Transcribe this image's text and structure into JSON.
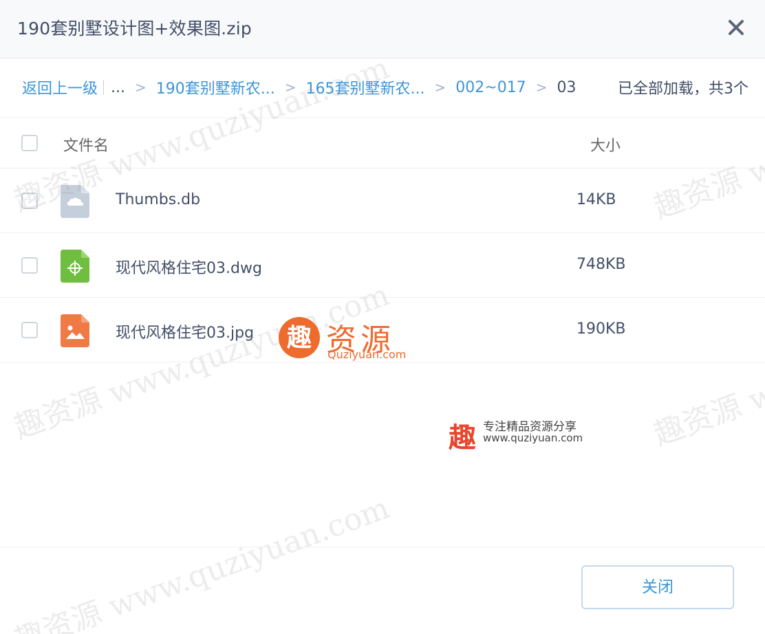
{
  "dialog": {
    "title": "190套别墅设计图+效果图.zip",
    "close_icon": "close-icon"
  },
  "breadcrumb": {
    "back_label": "返回上一级",
    "ellipsis": "...",
    "separator": ">",
    "items": [
      {
        "label": "190套别墅新农..."
      },
      {
        "label": "165套别墅新农..."
      },
      {
        "label": "002~017"
      }
    ],
    "current": "03"
  },
  "status": {
    "loaded_text": "已全部加载，共3个"
  },
  "list": {
    "header": {
      "name_label": "文件名",
      "size_label": "大小"
    },
    "files": [
      {
        "name": "Thumbs.db",
        "size": "14KB",
        "icon": "generic-file-icon",
        "color": "#c5cfdb"
      },
      {
        "name": "现代风格住宅03.dwg",
        "size": "748KB",
        "icon": "dwg-file-icon",
        "color": "#6fbe3f"
      },
      {
        "name": "现代风格住宅03.jpg",
        "size": "190KB",
        "icon": "image-file-icon",
        "color": "#f07a45"
      }
    ]
  },
  "footer": {
    "close_label": "关闭"
  },
  "watermark": {
    "text": "趣资源 www.quziyuan.com",
    "logo_name": "资源",
    "logo_mark": "趣",
    "logo_domain": "Quziyuan.com",
    "slogan": "专注精品资源分享",
    "slogan_url": "www.quziyuan.com"
  },
  "colors": {
    "link": "#3b95d8",
    "text": "#424e67",
    "brand": "#ee6b2e"
  }
}
